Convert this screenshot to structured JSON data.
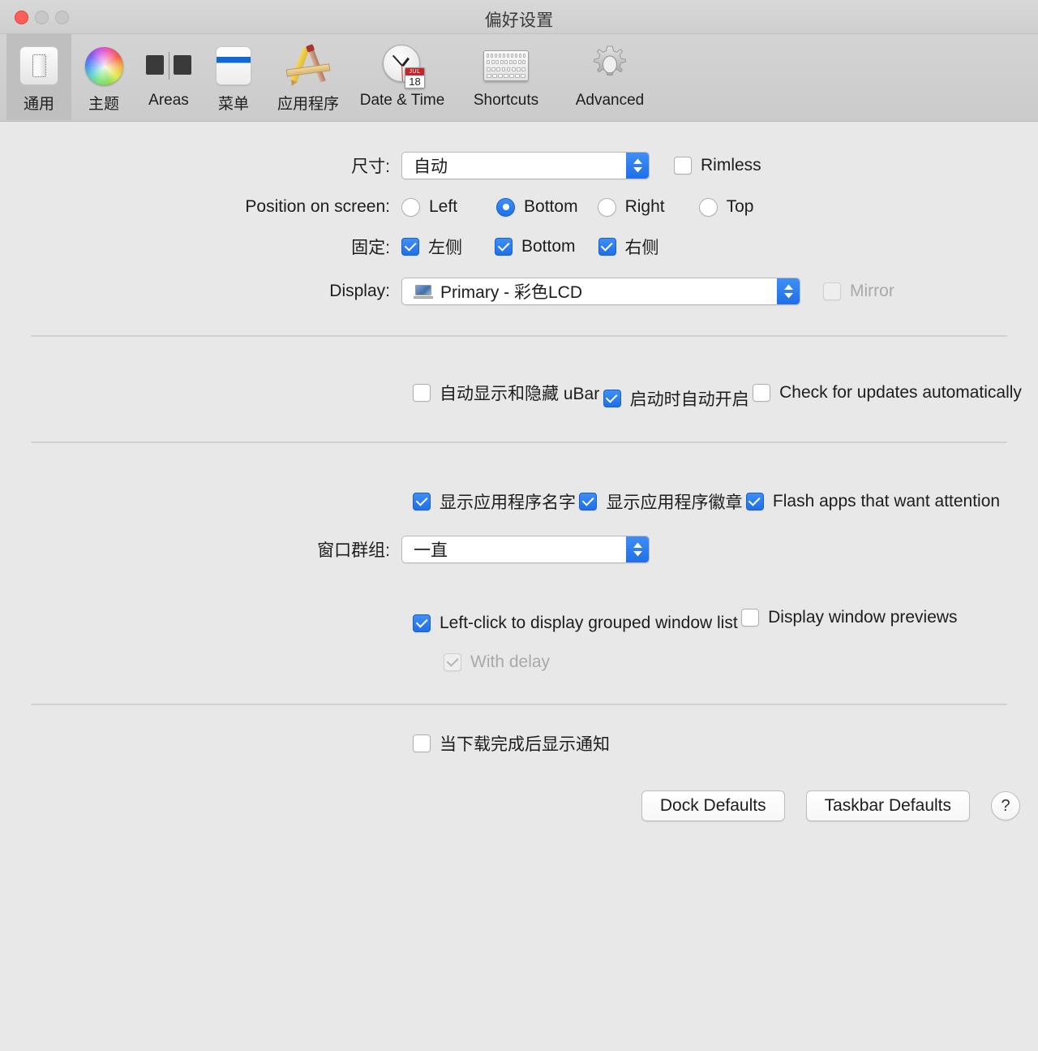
{
  "window": {
    "title": "偏好设置",
    "traffic_lights": [
      "close",
      "minimize",
      "maximize"
    ]
  },
  "toolbar": {
    "items": [
      {
        "label": "通用",
        "icon": "general-switch-icon",
        "selected": true
      },
      {
        "label": "主题",
        "icon": "color-wheel-icon",
        "selected": false
      },
      {
        "label": "Areas",
        "icon": "areas-blocks-icon",
        "selected": false
      },
      {
        "label": "菜单",
        "icon": "menu-window-icon",
        "selected": false
      },
      {
        "label": "应用程序",
        "icon": "applications-icon",
        "selected": false
      },
      {
        "label": "Date & Time",
        "icon": "clock-calendar-icon",
        "selected": false,
        "calendar_month": "JUL",
        "calendar_day": "18"
      },
      {
        "label": "Shortcuts",
        "icon": "keyboard-icon",
        "selected": false
      },
      {
        "label": "Advanced",
        "icon": "gear-icon",
        "selected": false
      }
    ]
  },
  "section1": {
    "size": {
      "label": "尺寸:",
      "value": "自动",
      "rimless": {
        "label": "Rimless",
        "checked": false
      }
    },
    "position": {
      "label": "Position on screen:",
      "options": [
        {
          "label": "Left",
          "selected": false
        },
        {
          "label": "Bottom",
          "selected": true
        },
        {
          "label": "Right",
          "selected": false
        },
        {
          "label": "Top",
          "selected": false
        }
      ]
    },
    "pinned": {
      "label": "固定:",
      "options": [
        {
          "label": "左侧",
          "checked": true
        },
        {
          "label": "Bottom",
          "checked": true
        },
        {
          "label": "右侧",
          "checked": true
        }
      ]
    },
    "display": {
      "label": "Display:",
      "value": "Primary - 彩色LCD",
      "icon": "laptop-icon",
      "mirror": {
        "label": "Mirror",
        "checked": false,
        "disabled": true
      }
    }
  },
  "section2": {
    "checkboxes": [
      {
        "label": "自动显示和隐藏 uBar",
        "checked": false
      },
      {
        "label": "启动时自动开启",
        "checked": true
      },
      {
        "label": "Check for updates automatically",
        "checked": false
      }
    ]
  },
  "section3": {
    "checkboxes": [
      {
        "label": "显示应用程序名字",
        "checked": true
      },
      {
        "label": "显示应用程序徽章",
        "checked": true
      },
      {
        "label": "Flash apps that want attention",
        "checked": true
      }
    ],
    "window_group": {
      "label": "窗口群组:",
      "value": "一直"
    },
    "sub_checkboxes": [
      {
        "label": "Left-click to display grouped window list",
        "checked": true,
        "disabled": false,
        "indent": 0
      },
      {
        "label": "Display window previews",
        "checked": false,
        "disabled": false,
        "indent": 0
      },
      {
        "label": "With delay",
        "checked": true,
        "disabled": true,
        "indent": 1
      }
    ]
  },
  "section4": {
    "checkboxes": [
      {
        "label": "当下载完成后显示通知",
        "checked": false
      }
    ]
  },
  "footer": {
    "dock_defaults": "Dock Defaults",
    "taskbar_defaults": "Taskbar Defaults",
    "help": "?"
  },
  "colors": {
    "accent": "#1f6fe8",
    "window_bg": "#e8e8e8",
    "toolbar_bg": "#cfcfcf",
    "close_button": "#ff5f57",
    "disabled_text": "#a9a9a9"
  }
}
